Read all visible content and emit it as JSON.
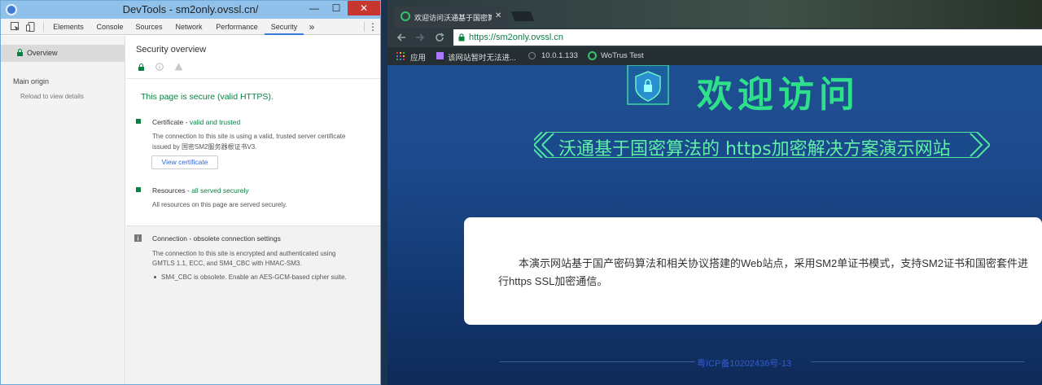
{
  "devtools": {
    "window_title": "DevTools - sm2only.ovssl.cn/",
    "window_buttons": {
      "minimize": "—",
      "maximize": "☐",
      "close": "✕"
    },
    "tabs": [
      "Elements",
      "Console",
      "Sources",
      "Network",
      "Performance",
      "Security"
    ],
    "active_tab": "Security",
    "more_tabs": "»",
    "menu": "⋮",
    "sidebar": {
      "overview": "Overview",
      "main_origin": "Main origin",
      "reload": "Reload to view details"
    },
    "main": {
      "title": "Security overview",
      "summary": "This page is secure (valid HTTPS).",
      "certificate": {
        "label": "Certificate - ",
        "status": "valid and trusted",
        "desc1": "The connection to this site is using a valid, trusted server certificate",
        "desc2": "issued by 国密SM2服务器根证书V3.",
        "button": "View certificate"
      },
      "resources": {
        "label": "Resources - ",
        "status": "all served securely",
        "desc": "All resources on this page are served securely."
      },
      "connection": {
        "title": "Connection - obsolete connection settings",
        "desc1": "The connection to this site is encrypted and authenticated using",
        "desc2": "GMTLS 1.1, ECC, and SM4_CBC with HMAC-SM3.",
        "bullet": "SM4_CBC is obsolete. Enable an AES-GCM-based cipher suite."
      }
    }
  },
  "browser": {
    "tab_title": "欢迎访问沃通基于国密算",
    "tab_close": "✕",
    "url": "https://sm2only.ovssl.cn",
    "bookmarks": [
      "应用",
      "该网站暂时无法进...",
      "10.0.1.133",
      "WoTrus Test"
    ],
    "page": {
      "hero_title": "欢迎访问",
      "banner": "沃通基于国密算法的 https加密解决方案演示网站",
      "card_text": "本演示网站基于国产密码算法和相关协议搭建的Web站点，采用SM2单证书模式，支持SM2证书和国密套件进行https SSL加密通信。",
      "footer": "粤ICP备10202436号-13"
    }
  },
  "colors": {
    "accent_green": "#0b8043",
    "devtools_blue": "#3879d9",
    "hero_green": "#2fe08a",
    "page_blue": "#1e4f92"
  }
}
